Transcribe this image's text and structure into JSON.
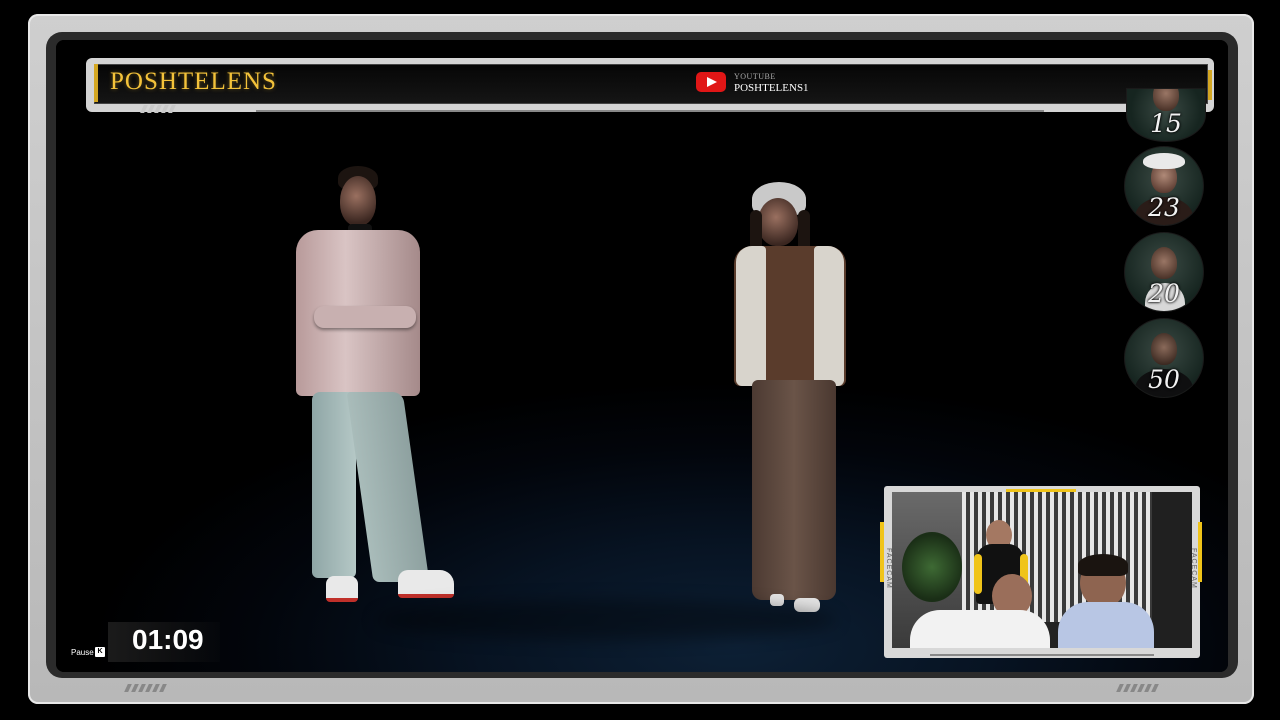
{
  "header": {
    "brand": "POSHTELENS",
    "youtube_small": "YOUTUBE",
    "youtube_channel": "POSHTELENS1"
  },
  "scoreboard": [
    {
      "score": "15"
    },
    {
      "score": "23"
    },
    {
      "score": "20"
    },
    {
      "score": "50"
    }
  ],
  "facecam": {
    "label_left": "FACECAM",
    "label_right": "FACECAM"
  },
  "player": {
    "timer": "01:09",
    "pause_label": "Pause",
    "pause_key": "K"
  },
  "colors": {
    "brand_gold": "#f3c23a",
    "youtube_red": "#e01616",
    "accent_yellow": "#f0c419"
  },
  "icons": {
    "youtube": "youtube-logo-icon"
  }
}
